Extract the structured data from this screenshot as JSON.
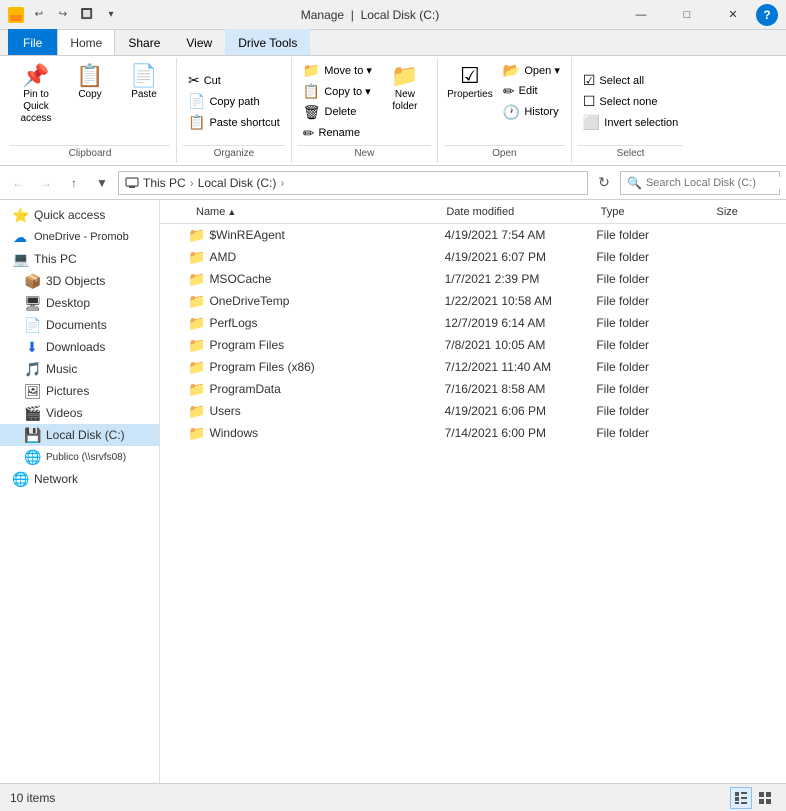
{
  "titleBar": {
    "title": "Local Disk (C:)",
    "manage": "Manage",
    "qat": [
      "undo",
      "redo",
      "properties",
      "dropdown"
    ],
    "controls": [
      "minimize",
      "maximize",
      "close"
    ]
  },
  "tabs": [
    {
      "id": "file",
      "label": "File"
    },
    {
      "id": "home",
      "label": "Home"
    },
    {
      "id": "share",
      "label": "Share"
    },
    {
      "id": "view",
      "label": "View"
    },
    {
      "id": "drivetools",
      "label": "Drive Tools"
    }
  ],
  "ribbon": {
    "groups": [
      {
        "id": "clipboard",
        "label": "Clipboard",
        "buttons": [
          {
            "id": "pin",
            "type": "large",
            "label": "Pin to Quick\naccess",
            "icon": "📌"
          },
          {
            "id": "copy",
            "type": "large",
            "label": "Copy",
            "icon": "📋"
          },
          {
            "id": "paste",
            "type": "large",
            "label": "Paste",
            "icon": "📄"
          }
        ],
        "small": []
      }
    ],
    "organize": {
      "label": "Organize",
      "smalls": [
        {
          "id": "cut",
          "label": "Cut",
          "icon": "✂"
        },
        {
          "id": "copypath",
          "label": "Copy path",
          "icon": "📄"
        },
        {
          "id": "pasteshortcut",
          "label": "Paste shortcut",
          "icon": "📋"
        }
      ]
    },
    "newGroup": {
      "label": "New",
      "buttons": [
        {
          "id": "moveto",
          "label": "Move to ▾",
          "icon": "📁"
        },
        {
          "id": "copyto",
          "label": "Copy to ▾",
          "icon": "📋"
        },
        {
          "id": "delete",
          "label": "Delete",
          "icon": "🗑"
        },
        {
          "id": "rename",
          "label": "Rename",
          "icon": "✏"
        },
        {
          "id": "newfolder",
          "label": "New\nfolder",
          "icon": "📁"
        }
      ]
    },
    "open": {
      "label": "Open",
      "smalls": [
        {
          "id": "open",
          "label": "Open ▾",
          "icon": "📂"
        },
        {
          "id": "edit",
          "label": "Edit",
          "icon": "✏"
        },
        {
          "id": "history",
          "label": "History",
          "icon": "🕐"
        }
      ]
    },
    "select": {
      "label": "Select",
      "smalls": [
        {
          "id": "selectall",
          "label": "Select all",
          "icon": "☑"
        },
        {
          "id": "selectnone",
          "label": "Select none",
          "icon": "☐"
        },
        {
          "id": "invertselection",
          "label": "Invert selection",
          "icon": "⬜"
        }
      ]
    }
  },
  "addressBar": {
    "path": [
      "This PC",
      "Local Disk (C:)"
    ],
    "searchPlaceholder": "Search Local Disk (C:)"
  },
  "sidebar": {
    "items": [
      {
        "id": "quickaccess",
        "label": "Quick access",
        "icon": "⭐",
        "indent": 0
      },
      {
        "id": "onedrive",
        "label": "OneDrive - Promob",
        "icon": "☁",
        "indent": 0
      },
      {
        "id": "thispc",
        "label": "This PC",
        "icon": "💻",
        "indent": 0
      },
      {
        "id": "3dobjects",
        "label": "3D Objects",
        "icon": "📦",
        "indent": 1
      },
      {
        "id": "desktop",
        "label": "Desktop",
        "icon": "🖥",
        "indent": 1
      },
      {
        "id": "documents",
        "label": "Documents",
        "icon": "📄",
        "indent": 1
      },
      {
        "id": "downloads",
        "label": "Downloads",
        "icon": "⬇",
        "indent": 1
      },
      {
        "id": "music",
        "label": "Music",
        "icon": "🎵",
        "indent": 1
      },
      {
        "id": "pictures",
        "label": "Pictures",
        "icon": "🖼",
        "indent": 1
      },
      {
        "id": "videos",
        "label": "Videos",
        "icon": "🎬",
        "indent": 1
      },
      {
        "id": "localdisk",
        "label": "Local Disk (C:)",
        "icon": "💾",
        "indent": 1,
        "selected": true
      },
      {
        "id": "publico",
        "label": "Publico (\\\\srvfs08)",
        "icon": "🌐",
        "indent": 1
      },
      {
        "id": "network",
        "label": "Network",
        "icon": "🌐",
        "indent": 0
      }
    ]
  },
  "fileList": {
    "columns": [
      "Name",
      "Date modified",
      "Type",
      "Size"
    ],
    "files": [
      {
        "name": "$WinREAgent",
        "date": "4/19/2021 7:54 AM",
        "type": "File folder",
        "size": ""
      },
      {
        "name": "AMD",
        "date": "4/19/2021 6:07 PM",
        "type": "File folder",
        "size": ""
      },
      {
        "name": "MSOCache",
        "date": "1/7/2021 2:39 PM",
        "type": "File folder",
        "size": ""
      },
      {
        "name": "OneDriveTemp",
        "date": "1/22/2021 10:58 AM",
        "type": "File folder",
        "size": ""
      },
      {
        "name": "PerfLogs",
        "date": "12/7/2019 6:14 AM",
        "type": "File folder",
        "size": ""
      },
      {
        "name": "Program Files",
        "date": "7/8/2021 10:05 AM",
        "type": "File folder",
        "size": ""
      },
      {
        "name": "Program Files (x86)",
        "date": "7/12/2021 11:40 AM",
        "type": "File folder",
        "size": ""
      },
      {
        "name": "ProgramData",
        "date": "7/16/2021 8:58 AM",
        "type": "File folder",
        "size": ""
      },
      {
        "name": "Users",
        "date": "4/19/2021 6:06 PM",
        "type": "File folder",
        "size": ""
      },
      {
        "name": "Windows",
        "date": "7/14/2021 6:00 PM",
        "type": "File folder",
        "size": ""
      }
    ]
  },
  "statusBar": {
    "itemCount": "10 items"
  }
}
